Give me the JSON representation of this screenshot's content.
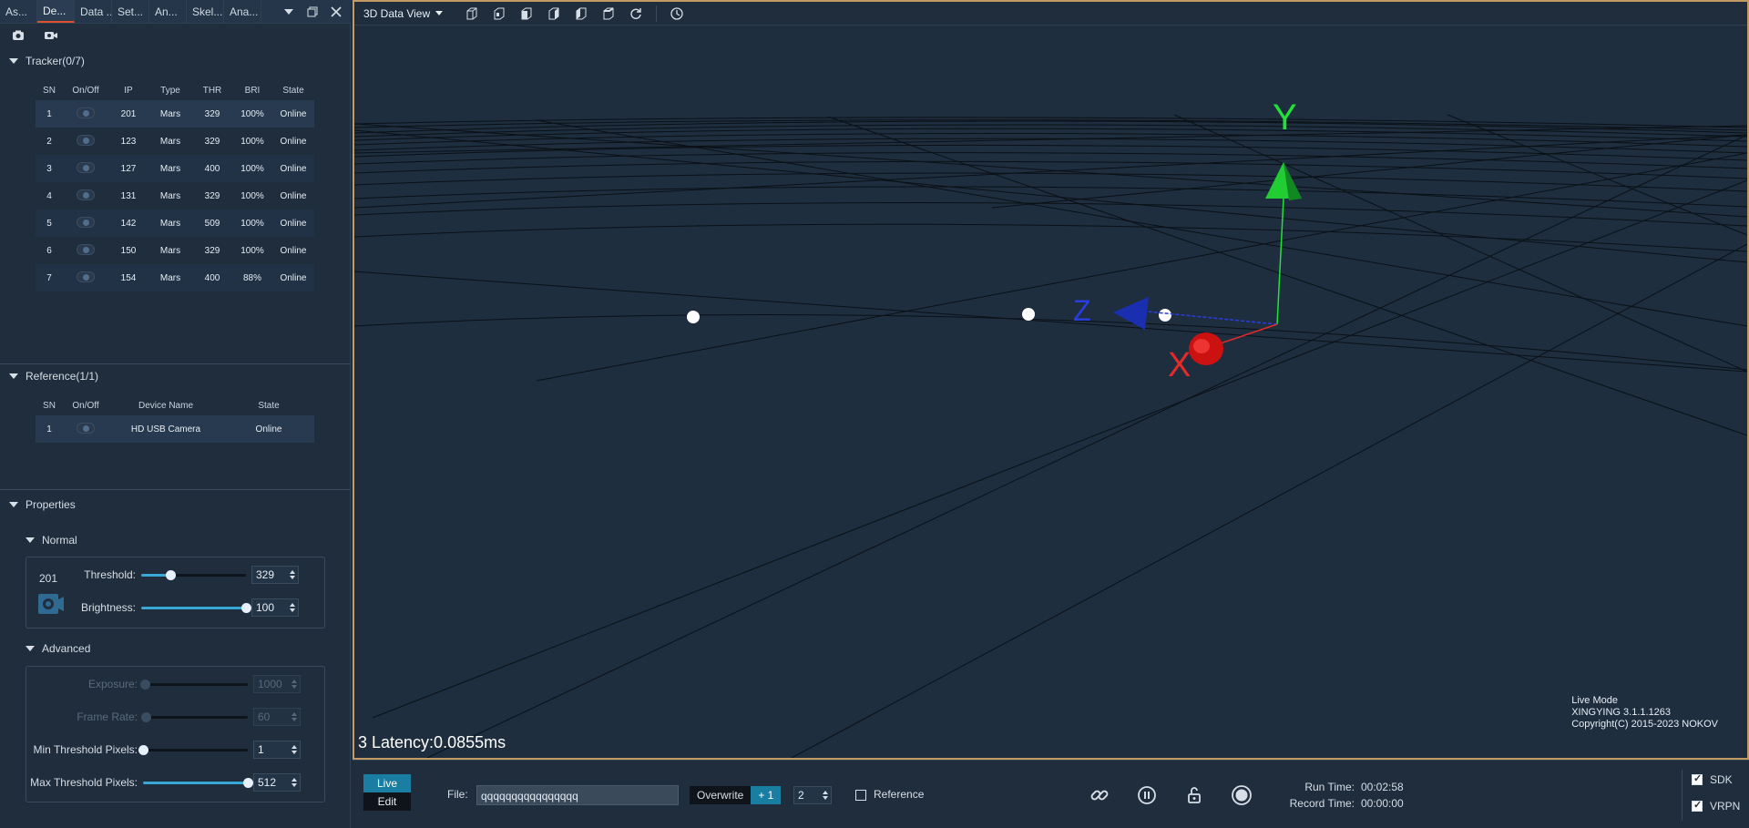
{
  "tabs": [
    "As...",
    "De...",
    "Data ...",
    "Set...",
    "An...",
    "Skel...",
    "Ana..."
  ],
  "tracker": {
    "title": "Tracker(0/7)",
    "headers": [
      "SN",
      "On/Off",
      "IP",
      "Type",
      "THR",
      "BRI",
      "State"
    ],
    "rows": [
      {
        "sn": "1",
        "ip": "201",
        "type": "Mars",
        "thr": "329",
        "bri": "100%",
        "state": "Online"
      },
      {
        "sn": "2",
        "ip": "123",
        "type": "Mars",
        "thr": "329",
        "bri": "100%",
        "state": "Online"
      },
      {
        "sn": "3",
        "ip": "127",
        "type": "Mars",
        "thr": "400",
        "bri": "100%",
        "state": "Online"
      },
      {
        "sn": "4",
        "ip": "131",
        "type": "Mars",
        "thr": "329",
        "bri": "100%",
        "state": "Online"
      },
      {
        "sn": "5",
        "ip": "142",
        "type": "Mars",
        "thr": "509",
        "bri": "100%",
        "state": "Online"
      },
      {
        "sn": "6",
        "ip": "150",
        "type": "Mars",
        "thr": "329",
        "bri": "100%",
        "state": "Online"
      },
      {
        "sn": "7",
        "ip": "154",
        "type": "Mars",
        "thr": "400",
        "bri": "88%",
        "state": "Online"
      }
    ]
  },
  "reference": {
    "title": "Reference(1/1)",
    "headers": [
      "SN",
      "On/Off",
      "Device Name",
      "State"
    ],
    "rows": [
      {
        "sn": "1",
        "name": "HD USB Camera",
        "state": "Online"
      }
    ]
  },
  "properties": {
    "title": "Properties",
    "normal": {
      "title": "Normal",
      "device_id": "201",
      "threshold_label": "Threshold:",
      "threshold_value": "329",
      "threshold_level": 0.28,
      "brightness_label": "Brightness:",
      "brightness_value": "100",
      "brightness_level": 1.0
    },
    "advanced": {
      "title": "Advanced",
      "exposure_label": "Exposure:",
      "exposure_value": "1000",
      "exposure_level": 0.02,
      "framerate_label": "Frame Rate:",
      "framerate_value": "60",
      "framerate_level": 0.03,
      "minpix_label": "Min Threshold Pixels:",
      "minpix_value": "1",
      "minpix_level": 0.0,
      "maxpix_label": "Max Threshold Pixels:",
      "maxpix_value": "512",
      "maxpix_level": 1.0
    }
  },
  "view": {
    "title": "3D Data View",
    "latency": "3 Latency:0.0855ms",
    "info": [
      "Live Mode",
      "XINGYING 3.1.1.1263",
      "Copyright(C) 2015-2023 NOKOV"
    ],
    "axis_labels": {
      "x": "X",
      "y": "Y",
      "z": "Z"
    }
  },
  "bottom": {
    "live": "Live",
    "edit": "Edit",
    "file_label": "File:",
    "file_value": "qqqqqqqqqqqqqqqq",
    "overwrite": "Overwrite",
    "plus": "+ 1",
    "count": "2",
    "reference_label": "Reference",
    "run_time_label": "Run Time:",
    "run_time_value": "00:02:58",
    "record_time_label": "Record Time:",
    "record_time_value": "00:00:00",
    "sdk_label": "SDK",
    "vrpn_label": "VRPN"
  },
  "colors": {
    "accent": "#1a7ea2",
    "online": "#66ddd4",
    "frame": "#c39a63",
    "tab_active": "#e0502d"
  }
}
